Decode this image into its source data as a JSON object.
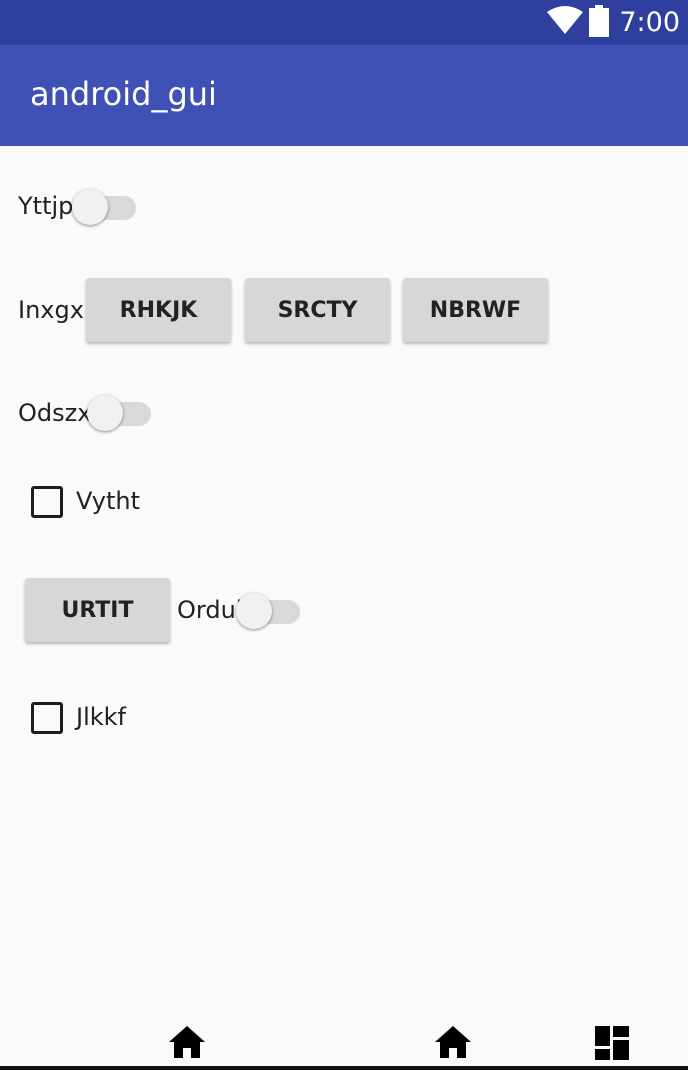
{
  "status_bar": {
    "time": "7:00",
    "icons": [
      "wifi-icon",
      "battery-icon"
    ],
    "color": "#2f3f9e"
  },
  "app_bar": {
    "title": "android_gui",
    "color": "#3f51b5"
  },
  "rows": {
    "row1": {
      "switch_label": "Yttjp",
      "switch_on": false
    },
    "row2": {
      "label": "Inxgx",
      "buttons": [
        "RHKJK",
        "SRCTY",
        "NBRWF"
      ]
    },
    "row3": {
      "switch_label": "Odszx",
      "switch_on": false
    },
    "row4": {
      "checkbox_label": "Vytht",
      "checked": false
    },
    "row5": {
      "button": "URTIT",
      "switch_label": "Ordui",
      "switch_on": false
    },
    "row6": {
      "checkbox_label": "Jlkkf",
      "checked": false
    }
  },
  "nav_bar": {
    "icons": [
      "home-icon",
      "home-icon",
      "dashboard-icon"
    ]
  }
}
